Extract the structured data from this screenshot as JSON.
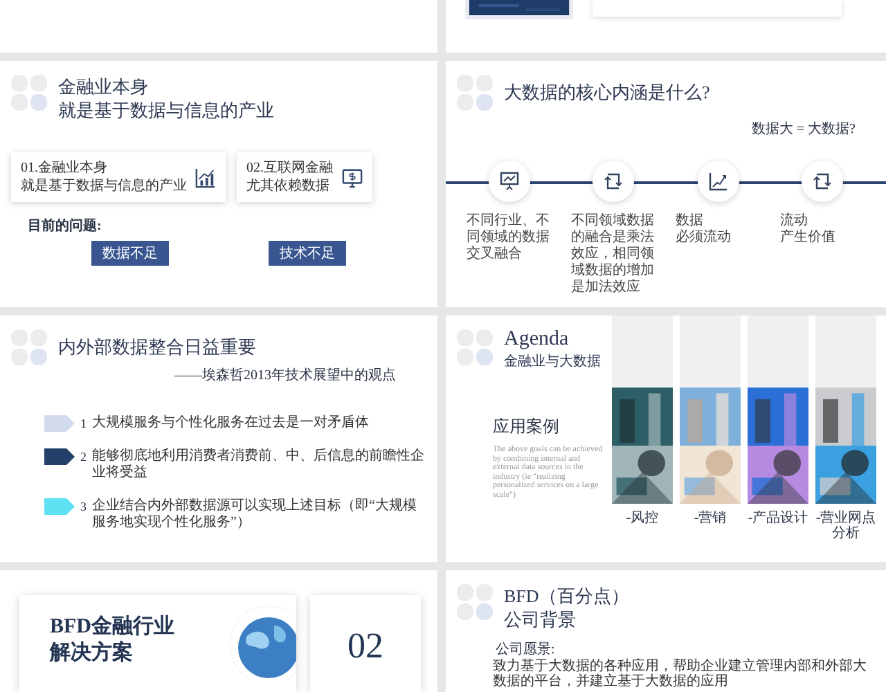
{
  "slides": [
    {
      "kind": "problems",
      "title_lines": [
        "金融业本身",
        "就是基于数据与信息的产业"
      ],
      "cards": [
        {
          "lines": [
            "01.金融业本身",
            "就是基于数据与信息的产业"
          ]
        },
        {
          "lines": [
            "02.互联网金融",
            "尤其依赖数据"
          ]
        }
      ],
      "label": "目前的问题:",
      "tags": [
        "数据不足",
        "技术不足"
      ]
    },
    {
      "kind": "timeline",
      "title": "大数据的核心内涵是什么?",
      "note": "数据大 = 大数据?",
      "steps": [
        {
          "text": "不同行业、不同领域的数据交叉融合"
        },
        {
          "text": "不同领域数据的融合是乘法效应，相同领域数据的增加是加法效应"
        },
        {
          "lines": [
            "数据",
            "必须流动"
          ]
        },
        {
          "lines": [
            "流动",
            "产生价值"
          ]
        }
      ]
    },
    {
      "kind": "list",
      "title": "内外部数据整合日益重要",
      "subtitle": "——埃森哲2013年技术展望中的观点",
      "items": [
        {
          "number": "1",
          "text": "大规模服务与个性化服务在过去是一对矛盾体",
          "color": "#d3dcee"
        },
        {
          "number": "2",
          "text": "能够彻底地利用消费者消费前、中、后信息的前瞻性企业将受益",
          "color": "#243f69"
        },
        {
          "number": "3",
          "text": "企业结合内外部数据源可以实现上述目标（即“大规模服务地实现个性化服务”）",
          "color": "#5ee2f3"
        }
      ]
    },
    {
      "kind": "agenda",
      "title": "Agenda",
      "subtitle": "金融业与大数据",
      "section": "应用案例",
      "body": "The above goals can be achieved by combining internal and external data sources in the industry (ie \"realizing personalized services on a large scale\")",
      "cases": [
        {
          "caption": "-风控"
        },
        {
          "caption": "-营销"
        },
        {
          "caption": "-产品设计"
        },
        {
          "caption": "-营业网点分析"
        }
      ]
    },
    {
      "kind": "cover",
      "title_lines": [
        "BFD金融行业",
        "解决方案"
      ],
      "number": "02"
    },
    {
      "kind": "company",
      "title": "BFD（百分点）",
      "subtitle": "公司背景",
      "section": "公司愿景:",
      "body": "致力基于大数据的各种应用，帮助企业建立管理内部和外部大数据的平台，并建立基于大数据的应用"
    }
  ]
}
